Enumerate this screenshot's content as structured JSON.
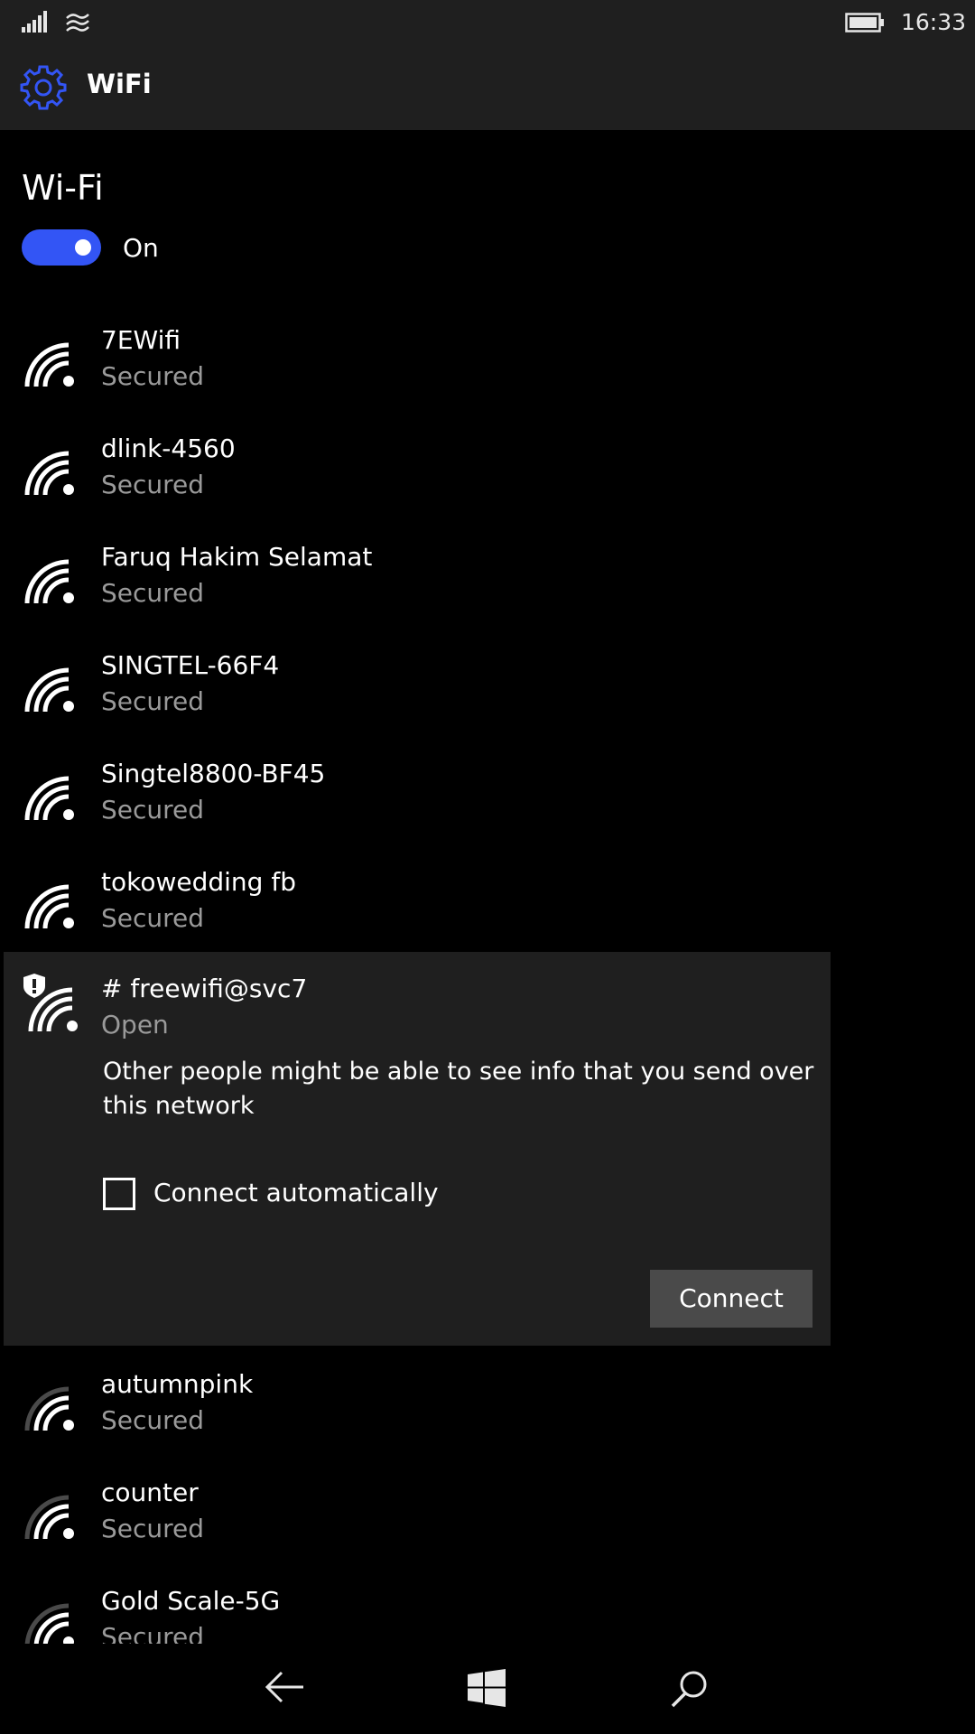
{
  "status_bar": {
    "time": "16:33",
    "icons": [
      "signal-icon",
      "wifi-status-icon",
      "battery-icon"
    ]
  },
  "header": {
    "title": "WiFi",
    "icon": "gear-icon",
    "accent_color": "#3355f5"
  },
  "wifi": {
    "section_title": "Wi-Fi",
    "toggle_state": "On",
    "toggle_on": true
  },
  "networks_top": [
    {
      "name": "7EWifi",
      "status": "Secured"
    },
    {
      "name": "dlink-4560",
      "status": "Secured"
    },
    {
      "name": "Faruq Hakim Selamat",
      "status": "Secured"
    },
    {
      "name": "SINGTEL-66F4",
      "status": "Secured"
    },
    {
      "name": "Singtel8800-BF45",
      "status": "Secured"
    },
    {
      "name": "tokowedding fb",
      "status": "Secured"
    }
  ],
  "selected_network": {
    "name": "# freewifi@svc7",
    "status": "Open",
    "warning": "Other people might be able to see info that you send over this network",
    "auto_connect_label": "Connect automatically",
    "auto_connect_checked": false,
    "connect_label": "Connect"
  },
  "networks_bottom": [
    {
      "name": "autumnpink",
      "status": "Secured"
    },
    {
      "name": "counter",
      "status": "Secured"
    },
    {
      "name": "Gold Scale-5G",
      "status": "Secured"
    }
  ],
  "nav_bar": {
    "icons": [
      "back-icon",
      "windows-home-icon",
      "search-icon"
    ]
  }
}
